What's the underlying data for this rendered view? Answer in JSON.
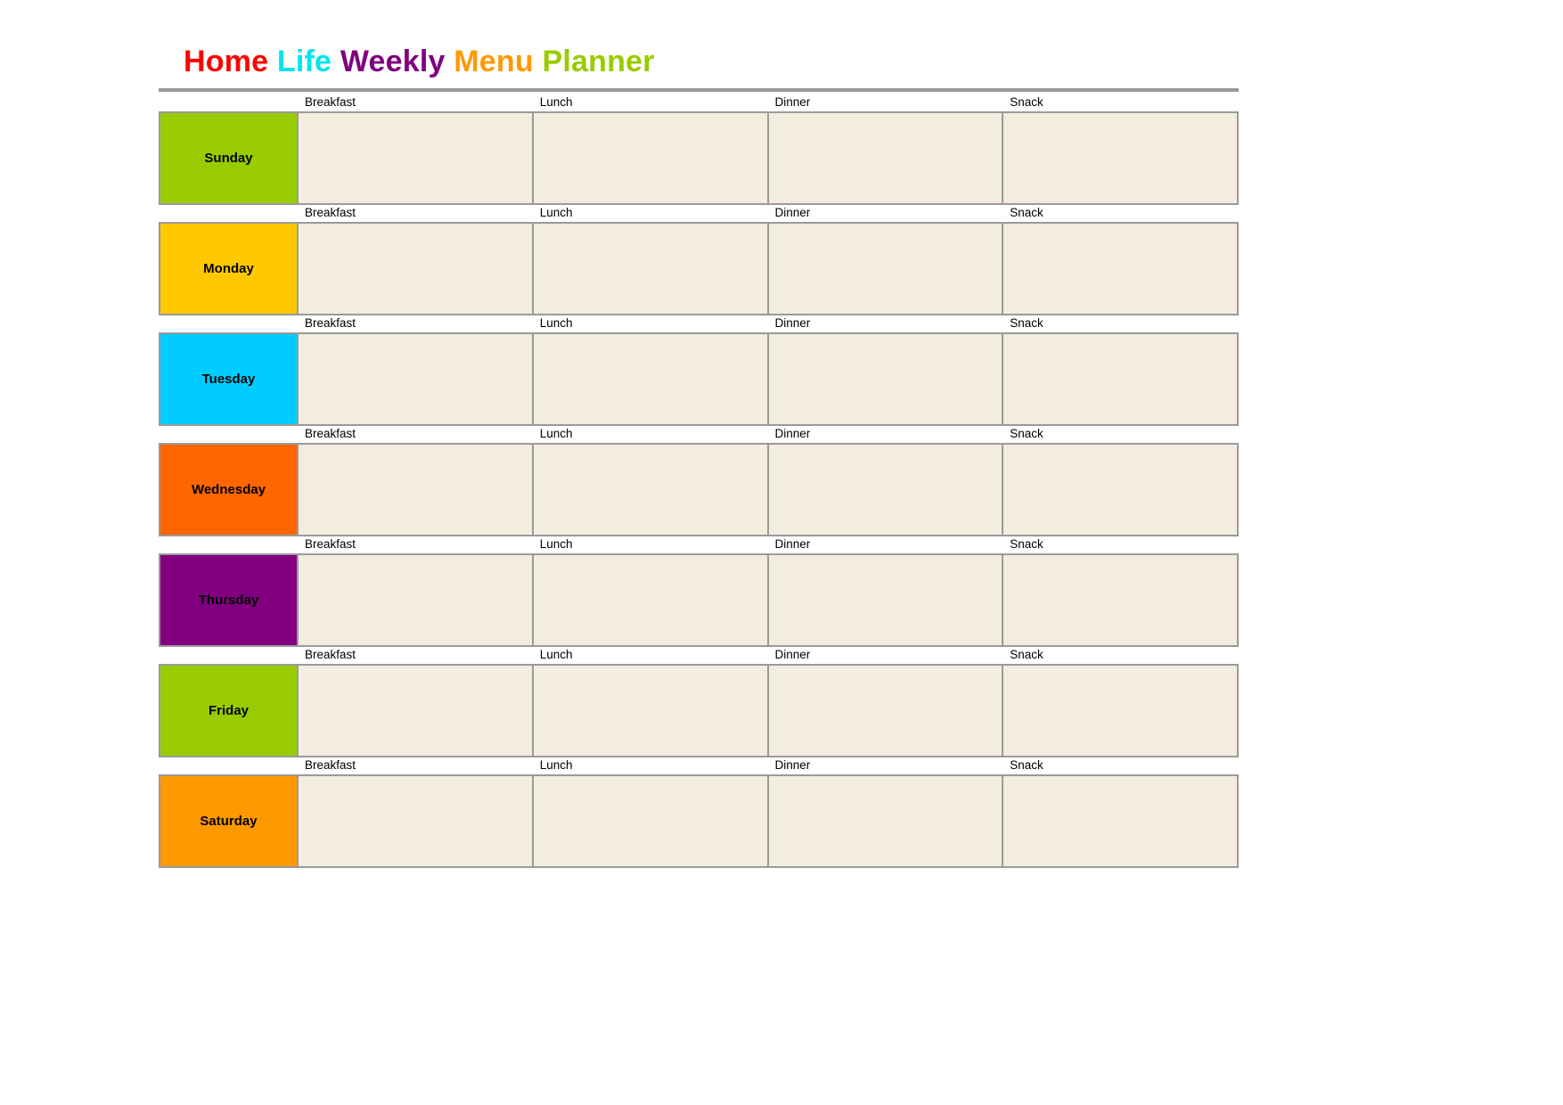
{
  "document": {
    "title_words": [
      {
        "text": "Home",
        "color": "#FF0000"
      },
      {
        "text": "Life",
        "color": "#00E5EE"
      },
      {
        "text": "Weekly",
        "color": "#800080"
      },
      {
        "text": "Menu",
        "color": "#FF9900"
      },
      {
        "text": "Planner",
        "color": "#99CC00"
      }
    ],
    "title_plain": "Home Life Weekly Menu Planner"
  },
  "columns": {
    "day_header": "",
    "meals": [
      "Breakfast",
      "Lunch",
      "Dinner",
      "Snack"
    ]
  },
  "colors": {
    "rule": "#9a9a9a",
    "cell_background": "#F2EDDF",
    "cell_border": "#9a9a9a",
    "page_background": "#FFFFFF"
  },
  "days": [
    {
      "label": "Sunday",
      "color": "#99CC00",
      "meals": {
        "breakfast": "",
        "lunch": "",
        "dinner": "",
        "snack": ""
      }
    },
    {
      "label": "Monday",
      "color": "#FFC800",
      "meals": {
        "breakfast": "",
        "lunch": "",
        "dinner": "",
        "snack": ""
      }
    },
    {
      "label": "Tuesday",
      "color": "#00CCFF",
      "meals": {
        "breakfast": "",
        "lunch": "",
        "dinner": "",
        "snack": ""
      }
    },
    {
      "label": "Wednesday",
      "color": "#FF6600",
      "meals": {
        "breakfast": "",
        "lunch": "",
        "dinner": "",
        "snack": ""
      }
    },
    {
      "label": "Thursday",
      "color": "#800080",
      "meals": {
        "breakfast": "",
        "lunch": "",
        "dinner": "",
        "snack": ""
      }
    },
    {
      "label": "Friday",
      "color": "#99CC00",
      "meals": {
        "breakfast": "",
        "lunch": "",
        "dinner": "",
        "snack": ""
      }
    },
    {
      "label": "Saturday",
      "color": "#FF9900",
      "meals": {
        "breakfast": "",
        "lunch": "",
        "dinner": "",
        "snack": ""
      }
    }
  ]
}
